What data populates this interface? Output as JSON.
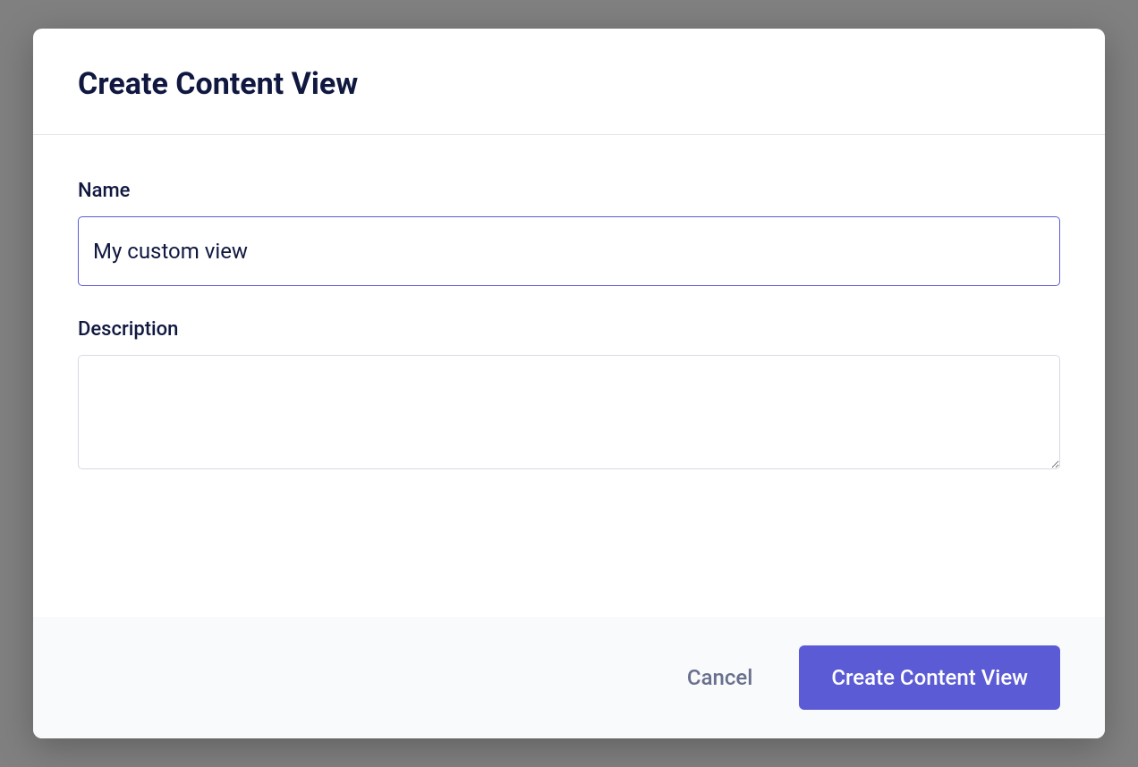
{
  "modal": {
    "title": "Create Content View",
    "fields": {
      "name": {
        "label": "Name",
        "value": "My custom view"
      },
      "description": {
        "label": "Description",
        "value": ""
      }
    },
    "actions": {
      "cancel": "Cancel",
      "submit": "Create Content View"
    }
  },
  "colors": {
    "accent": "#5b5bd6",
    "text_primary": "#101840",
    "text_secondary": "#696f8c",
    "footer_bg": "#f9fafc",
    "border": "#d8dae5"
  }
}
